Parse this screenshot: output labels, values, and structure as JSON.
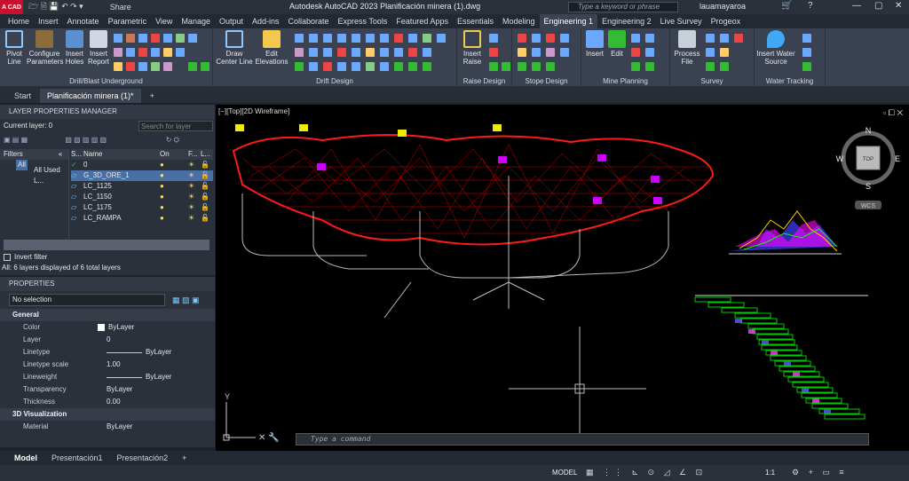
{
  "titlebar": {
    "logo": "A CAD",
    "title": "Autodesk AutoCAD 2023   Planificación minera (1).dwg",
    "share": "Share",
    "search_placeholder": "Type a keyword or phrase",
    "user": "lauamayaroa"
  },
  "menu": [
    "Home",
    "Insert",
    "Annotate",
    "Parametric",
    "View",
    "Manage",
    "Output",
    "Add-ins",
    "Collaborate",
    "Express Tools",
    "Featured Apps",
    "Essentials",
    "Modeling",
    "Engineering 1",
    "Engineering 2",
    "Live Survey",
    "Progeox"
  ],
  "active_menu": "Engineering 1",
  "ribbon": {
    "groups": [
      {
        "label": "Drill/Blast Underground",
        "buttons": [
          "Pivot Line",
          "Configure Parameters",
          "Insert Holes",
          "Insert Report"
        ]
      },
      {
        "label": "Drift Design",
        "buttons": [
          "Draw Center Line",
          "Edit Elevations"
        ]
      },
      {
        "label": "Raise Design",
        "buttons": [
          "Insert Raise"
        ]
      },
      {
        "label": "Stope Design",
        "buttons": []
      },
      {
        "label": "Mine Planning",
        "buttons": [
          "Insert",
          "Edit"
        ]
      },
      {
        "label": "Survey",
        "buttons": [
          "Process File"
        ]
      },
      {
        "label": "Water Tracking",
        "buttons": [
          "Insert Water Source"
        ]
      }
    ]
  },
  "doc_tabs": [
    "Start",
    "Planificación minera (1)*"
  ],
  "layer_manager": {
    "title": "LAYER PROPERTIES MANAGER",
    "current_layer": "Current layer: 0",
    "search_placeholder": "Search for layer",
    "filters_label": "Filters",
    "tree": [
      "All",
      "All Used L..."
    ],
    "columns": [
      "S...",
      "Name",
      "On",
      "F...",
      "L..."
    ],
    "layers": [
      "0",
      "G_3D_ORE_1",
      "LC_1125",
      "LC_1150",
      "LC_1175",
      "LC_RAMPA"
    ],
    "invert_filter": "Invert filter",
    "summary": "All: 6 layers displayed of 6 total layers"
  },
  "properties": {
    "title": "PROPERTIES",
    "selection": "No selection",
    "general_label": "General",
    "rows": [
      {
        "k": "Color",
        "v": "ByLayer"
      },
      {
        "k": "Layer",
        "v": "0"
      },
      {
        "k": "Linetype",
        "v": "ByLayer"
      },
      {
        "k": "Linetype scale",
        "v": "1.00"
      },
      {
        "k": "Lineweight",
        "v": "ByLayer"
      },
      {
        "k": "Transparency",
        "v": "ByLayer"
      },
      {
        "k": "Thickness",
        "v": "0.00"
      }
    ],
    "viz_label": "3D Visualization",
    "viz_rows": [
      {
        "k": "Material",
        "v": "ByLayer"
      }
    ]
  },
  "viewport": {
    "label": "[−][Top][2D Wireframe]",
    "viewcube": "TOP",
    "compass": [
      "N",
      "E",
      "S",
      "W"
    ],
    "wcs": "WCS",
    "cmd_placeholder": "Type a command",
    "y_axis": "Y"
  },
  "layout_tabs": [
    "Model",
    "Presentación1",
    "Presentación2"
  ],
  "status": {
    "model": "MODEL",
    "scale": "1:1"
  }
}
